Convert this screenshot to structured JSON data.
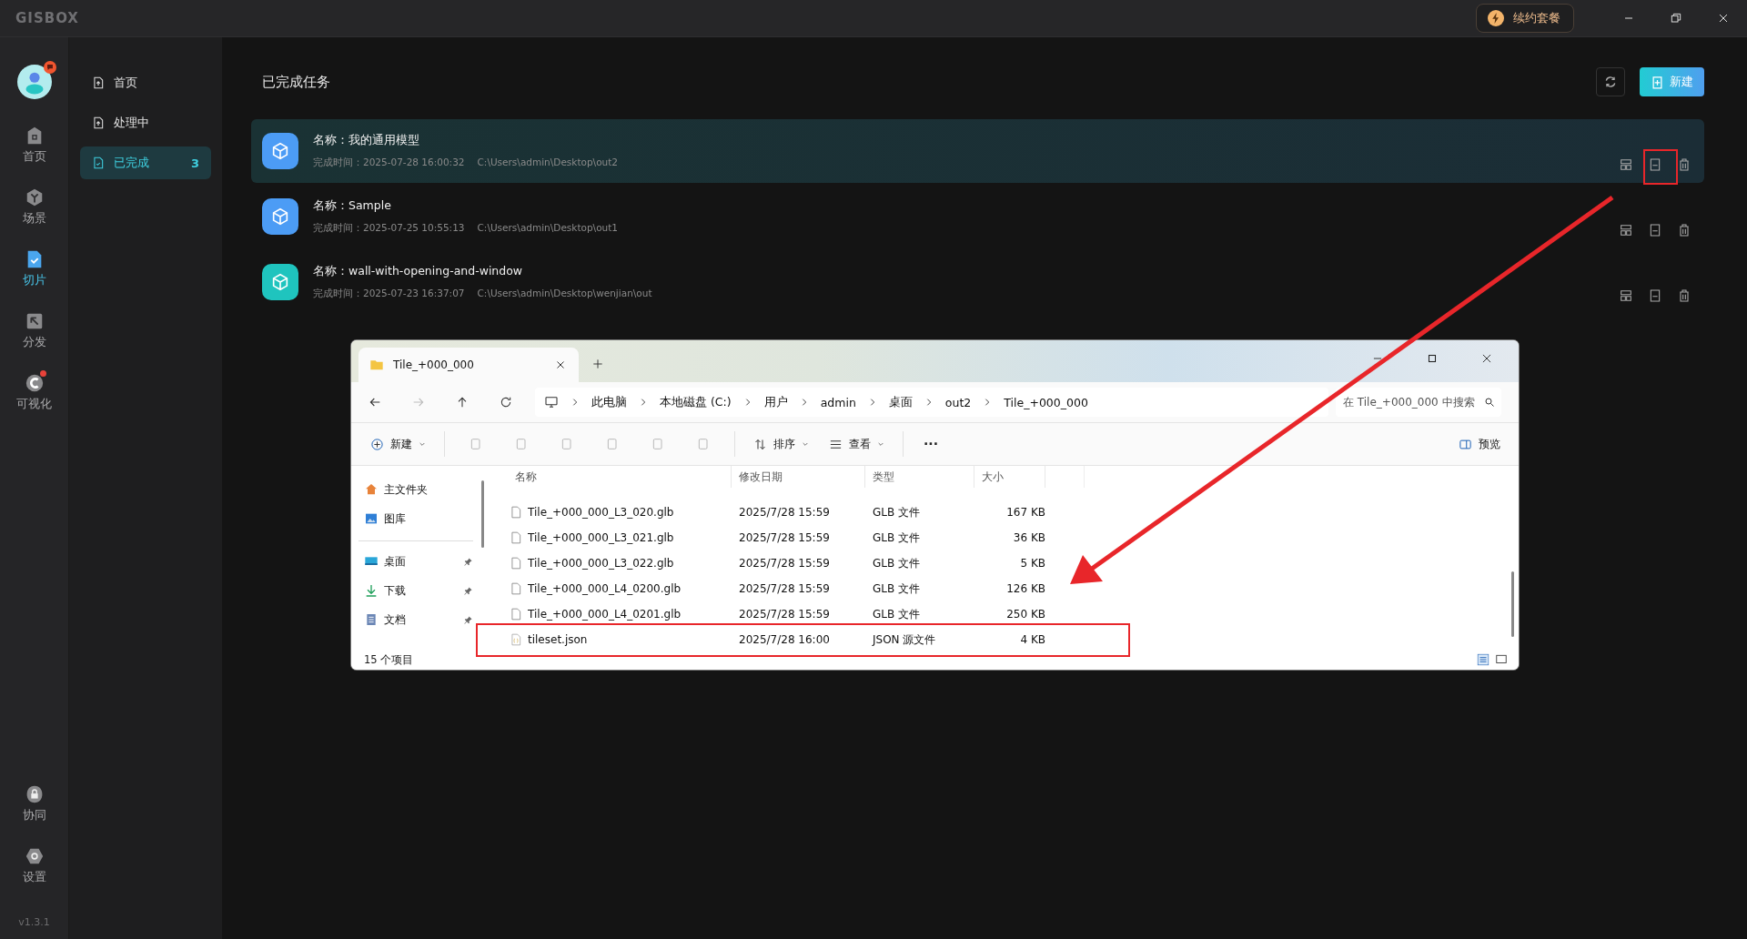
{
  "titlebar": {
    "logo": "GISBOX",
    "renew_button": "续约套餐"
  },
  "rail": {
    "items": [
      {
        "label": "首页",
        "selected": false,
        "badge": false
      },
      {
        "label": "场景",
        "selected": false,
        "badge": false
      },
      {
        "label": "切片",
        "selected": true,
        "badge": false
      },
      {
        "label": "分发",
        "selected": false,
        "badge": false
      },
      {
        "label": "可视化",
        "selected": false,
        "badge": true
      }
    ],
    "bottom_items": [
      {
        "label": "协同",
        "selected": false,
        "badge": false
      },
      {
        "label": "设置",
        "selected": false,
        "badge": false
      }
    ],
    "version": "v1.3.1"
  },
  "subnav": {
    "items": [
      {
        "label": "首页",
        "selected": false
      },
      {
        "label": "处理中",
        "selected": false
      },
      {
        "label": "已完成",
        "selected": true,
        "count": "3"
      }
    ]
  },
  "main": {
    "title": "已完成任务",
    "new_button": "新建",
    "tasks": [
      {
        "name_label": "名称：",
        "name": "我的通用模型",
        "time_label": "完成时间：",
        "time": "2025-07-28 16:00:32",
        "path": "C:\\Users\\admin\\Desktop\\out2",
        "selected": true,
        "color": "#4c9cf5"
      },
      {
        "name_label": "名称：",
        "name": "Sample",
        "time_label": "完成时间：",
        "time": "2025-07-25 10:55:13",
        "path": "C:\\Users\\admin\\Desktop\\out1",
        "selected": false,
        "color": "#4c9cf5"
      },
      {
        "name_label": "名称：",
        "name": "wall-with-opening-and-window",
        "time_label": "完成时间：",
        "time": "2025-07-23 16:37:07",
        "path": "C:\\Users\\admin\\Desktop\\wenjian\\out",
        "selected": false,
        "color": "#1fc4be"
      }
    ]
  },
  "explorer": {
    "tab_title": "Tile_+000_000",
    "breadcrumb": [
      "此电脑",
      "本地磁盘 (C:)",
      "用户",
      "admin",
      "桌面",
      "out2",
      "Tile_+000_000"
    ],
    "search": {
      "placeholder": "在 Tile_+000_000 中搜索"
    },
    "toolbar": {
      "new": "新建",
      "sort": "排序",
      "view": "查看",
      "more": "···",
      "preview": "预览"
    },
    "nav_items": [
      {
        "label": "主文件夹",
        "pinned": false
      },
      {
        "label": "图库",
        "pinned": false
      },
      {
        "label": "桌面",
        "pinned": true
      },
      {
        "label": "下载",
        "pinned": true
      },
      {
        "label": "文档",
        "pinned": true
      }
    ],
    "columns": [
      "名称",
      "修改日期",
      "类型",
      "大小"
    ],
    "files": [
      {
        "name": "Tile_+000_000_L3_020.glb",
        "date": "2025/7/28 15:59",
        "type": "GLB 文件",
        "size": "167 KB",
        "kind": "file"
      },
      {
        "name": "Tile_+000_000_L3_021.glb",
        "date": "2025/7/28 15:59",
        "type": "GLB 文件",
        "size": "36 KB",
        "kind": "file"
      },
      {
        "name": "Tile_+000_000_L3_022.glb",
        "date": "2025/7/28 15:59",
        "type": "GLB 文件",
        "size": "5 KB",
        "kind": "file"
      },
      {
        "name": "Tile_+000_000_L4_0200.glb",
        "date": "2025/7/28 15:59",
        "type": "GLB 文件",
        "size": "126 KB",
        "kind": "file"
      },
      {
        "name": "Tile_+000_000_L4_0201.glb",
        "date": "2025/7/28 15:59",
        "type": "GLB 文件",
        "size": "250 KB",
        "kind": "file"
      },
      {
        "name": "tileset.json",
        "date": "2025/7/28 16:00",
        "type": "JSON 源文件",
        "size": "4 KB",
        "kind": "json"
      }
    ],
    "status": "15 个项目"
  }
}
